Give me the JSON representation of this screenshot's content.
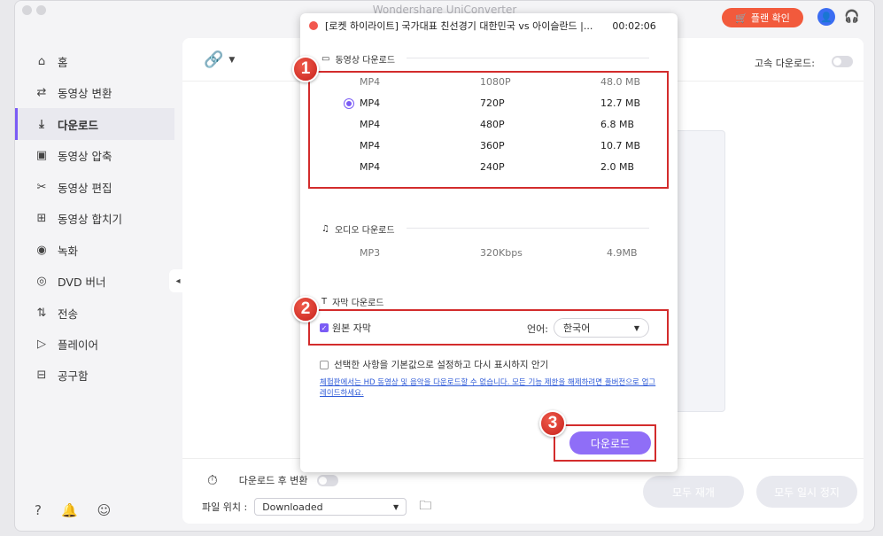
{
  "window": {
    "title": "Wondershare UniConverter",
    "plan_button": "플랜 확인"
  },
  "sidebar": {
    "items": [
      {
        "label": "홈",
        "icon": "home-icon",
        "glyph": "⌂"
      },
      {
        "label": "동영상 변환",
        "icon": "convert-icon",
        "glyph": "⇄"
      },
      {
        "label": "다운로드",
        "icon": "download-icon",
        "glyph": "⤓"
      },
      {
        "label": "동영상 압축",
        "icon": "compress-icon",
        "glyph": "▣"
      },
      {
        "label": "동영상 편집",
        "icon": "scissors-icon",
        "glyph": "✂"
      },
      {
        "label": "동영상 합치기",
        "icon": "merge-icon",
        "glyph": "⊞"
      },
      {
        "label": "녹화",
        "icon": "record-icon",
        "glyph": "◉"
      },
      {
        "label": "DVD 버너",
        "icon": "dvd-icon",
        "glyph": "◎"
      },
      {
        "label": "전송",
        "icon": "transfer-icon",
        "glyph": "⇅"
      },
      {
        "label": "플레이어",
        "icon": "player-icon",
        "glyph": "▷"
      },
      {
        "label": "공구함",
        "icon": "toolbox-icon",
        "glyph": "⊟"
      }
    ],
    "active_index": 2
  },
  "main": {
    "speed_label": "고속 다운로드:",
    "after_convert_label": "다운로드 후 변환",
    "file_location_label": "파일 위치 :",
    "file_location_value": "Downloaded",
    "resume_all": "모두 재개",
    "pause_all": "모두 일시 정지"
  },
  "modal": {
    "video_title": "[로켓 하이라이트] 국가대표 친선경기 대한민국 vs 아이슬란드 |...",
    "duration": "00:02:06",
    "video_section": "동영상 다운로드",
    "video_rows": [
      {
        "format": "MP4",
        "resolution": "1080P",
        "size": "48.0 MB",
        "dim": true
      },
      {
        "format": "MP4",
        "resolution": "720P",
        "size": "12.7 MB",
        "selected": true
      },
      {
        "format": "MP4",
        "resolution": "480P",
        "size": "6.8 MB"
      },
      {
        "format": "MP4",
        "resolution": "360P",
        "size": "10.7 MB"
      },
      {
        "format": "MP4",
        "resolution": "240P",
        "size": "2.0 MB"
      }
    ],
    "audio_section": "오디오 다운로드",
    "audio_rows": [
      {
        "format": "MP3",
        "bitrate": "320Kbps",
        "size": "4.9MB"
      }
    ],
    "subtitle_section": "자막 다운로드",
    "original_subtitle": "원본 자막",
    "language_label": "언어:",
    "language_value": "한국어",
    "default_setting": "선택한 사항을 기본값으로 설정하고 다시 표시하지 안기",
    "notice": "체험판에서는 HD 동영상 및 음악을 다운로드할 수 없습니다. 모든 기능 제한을 해제하려면 풀버전으로 업그레이드하세요.",
    "download_button": "다운로드"
  },
  "annotations": {
    "badge1": "1",
    "badge2": "2",
    "badge3": "3"
  },
  "colors": {
    "accent": "#7b5cf5",
    "annotation": "#d32c2c",
    "plan": "#f25a3c"
  }
}
